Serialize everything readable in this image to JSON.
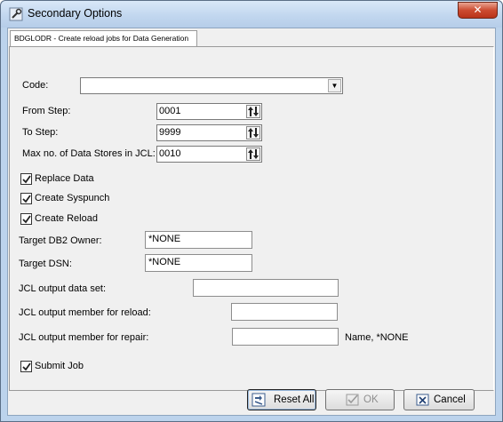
{
  "window": {
    "title": "Secondary Options",
    "close_label": "✕"
  },
  "tab": {
    "label": "BDGLODR - Create reload jobs for Data Generation"
  },
  "form": {
    "code": {
      "label": "Code:",
      "value": ""
    },
    "from_step": {
      "label": "From Step:",
      "value": "0001"
    },
    "to_step": {
      "label": "To Step:",
      "value": "9999"
    },
    "max_stores": {
      "label": "Max no. of Data Stores in JCL:",
      "value": "0010"
    },
    "replace_data": {
      "label": "Replace Data",
      "checked": true
    },
    "create_syspunch": {
      "label": "Create Syspunch",
      "checked": true
    },
    "create_reload": {
      "label": "Create Reload",
      "checked": true
    },
    "target_db2_owner": {
      "label": "Target DB2 Owner:",
      "value": "*NONE"
    },
    "target_dsn": {
      "label": "Target DSN:",
      "value": "*NONE"
    },
    "jcl_output_data_set": {
      "label": "JCL output data set:",
      "value": ""
    },
    "jcl_member_reload": {
      "label": "JCL output member for reload:",
      "value": ""
    },
    "jcl_member_repair": {
      "label": "JCL output member for repair:",
      "value": "",
      "hint": "Name, *NONE"
    },
    "submit_job": {
      "label": "Submit Job",
      "checked": true
    }
  },
  "buttons": {
    "reset_all": "Reset All",
    "ok": "OK",
    "cancel": "Cancel"
  },
  "icons": {
    "app": "wrench-icon",
    "spin": "up-down-arrows-icon",
    "reset": "reset-icon",
    "ok": "check-icon",
    "cancel": "x-box-icon"
  }
}
